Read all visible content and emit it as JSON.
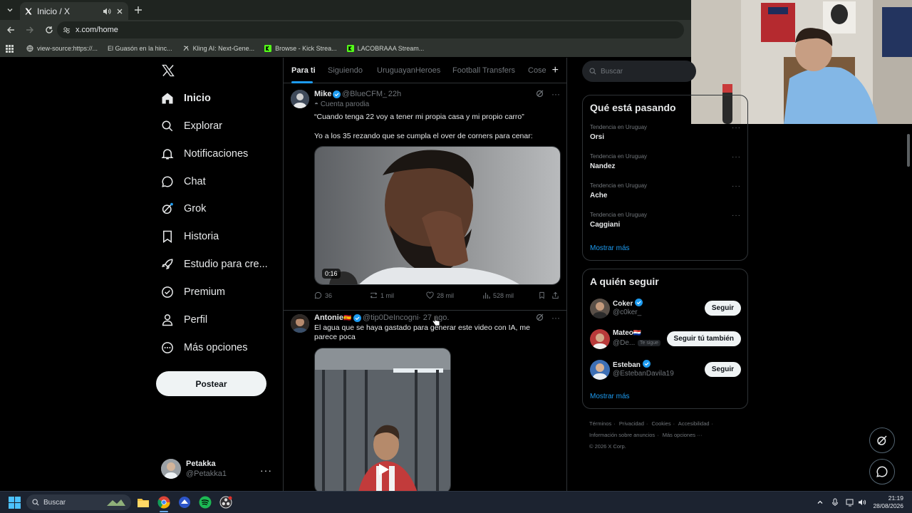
{
  "browser": {
    "tab_title": "Inicio / X",
    "url": "x.com/home",
    "bookmarks": [
      {
        "label": "view-source:https://...",
        "icon": "globe-icon"
      },
      {
        "label": "El Guasón en la hinc...",
        "icon": "none"
      },
      {
        "label": "Kling AI: Next-Gene...",
        "icon": "kling-icon"
      },
      {
        "label": "Browse - Kick Strea...",
        "icon": "kick-icon"
      },
      {
        "label": "LACOBRAAA Stream...",
        "icon": "kick-icon"
      }
    ]
  },
  "nav": {
    "items": [
      {
        "label": "Inicio",
        "icon": "home-icon",
        "active": true
      },
      {
        "label": "Explorar",
        "icon": "search-icon"
      },
      {
        "label": "Notificaciones",
        "icon": "bell-icon"
      },
      {
        "label": "Chat",
        "icon": "chat-icon"
      },
      {
        "label": "Grok",
        "icon": "grok-icon"
      },
      {
        "label": "Historia",
        "icon": "bookmark-icon"
      },
      {
        "label": "Estudio para cre...",
        "icon": "rocket-icon"
      },
      {
        "label": "Premium",
        "icon": "verified-icon"
      },
      {
        "label": "Perfil",
        "icon": "person-icon"
      },
      {
        "label": "Más opciones",
        "icon": "more-circle-icon"
      }
    ],
    "post_label": "Postear",
    "account": {
      "name": "Petakka",
      "handle": "@Petakka1"
    }
  },
  "feed": {
    "tabs": [
      "Para ti",
      "Siguiendo",
      "UruguayanHeroes",
      "Football Transfers",
      "Cose"
    ],
    "tweets": [
      {
        "name": "Mike",
        "handle": "@BlueCFM_",
        "time": "· 22h",
        "label": "Cuenta parodia",
        "text1": "“Cuando tenga 22 voy a tener mi propia casa y mi propio carro”",
        "text2": "Yo a los 35 rezando que se cumpla el over de corners para cenar:",
        "duration": "0:16",
        "replies": "36",
        "reposts": "1 mil",
        "likes": "28 mil",
        "views": "528 mil"
      },
      {
        "name": "Antonie",
        "flag": "🇪🇸",
        "handle": "@tip0DeIncogni",
        "time": "· 27 ago.",
        "text1": "El agua que se haya gastado para generar este video con IA, me parece poca"
      }
    ]
  },
  "sidebar": {
    "search_placeholder": "Buscar",
    "trends_title": "Qué está pasando",
    "trends": [
      {
        "category": "Tendencia en Uruguay",
        "name": "Orsi"
      },
      {
        "category": "Tendencia en Uruguay",
        "name": "Nandez"
      },
      {
        "category": "Tendencia en Uruguay",
        "name": "Ache"
      },
      {
        "category": "Tendencia en Uruguay",
        "name": "Caggiani"
      }
    ],
    "show_more": "Mostrar más",
    "follow_title": "A quién seguir",
    "follow": [
      {
        "name": "Coker",
        "handle": "@c0ker_",
        "button": "Seguir",
        "verified": true
      },
      {
        "name": "Mateo",
        "flag": "🇵🇾",
        "handle": "@De...",
        "badge": "Te sigue",
        "button": "Seguir tú también"
      },
      {
        "name": "Esteban",
        "handle": "@EstebanDavila19",
        "button": "Seguir",
        "verified": true
      }
    ],
    "follow_show_more": "Mostrar más",
    "footer": [
      "Términos",
      "Privacidad",
      "Cookies",
      "Accesibilidad",
      "Información sobre anuncios",
      "Más opciones ···",
      "© 2026 X Corp."
    ]
  },
  "taskbar": {
    "search": "Buscar",
    "time": "21:19",
    "date": "28/08/2026"
  },
  "colors": {
    "accent": "#1d9bf0",
    "background": "#000000",
    "border": "#2f3336"
  }
}
